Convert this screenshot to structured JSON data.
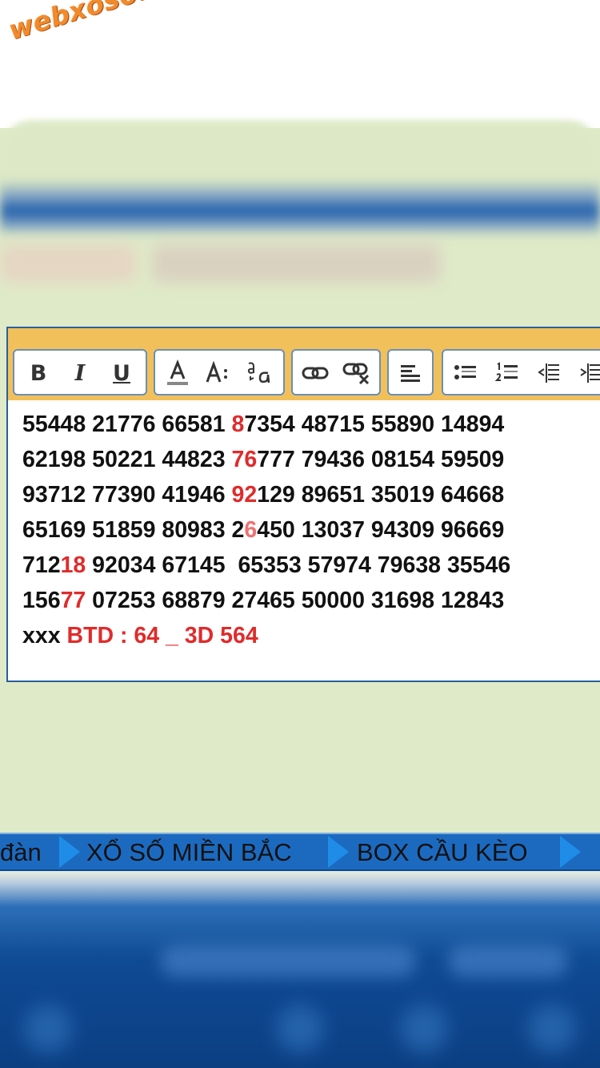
{
  "logo": {
    "text": "webxoso.net",
    "color": "#f28a2c"
  },
  "toolbar": {
    "bold_label": "B",
    "italic_label": "I",
    "underline_label": "U",
    "buttons": [
      "bold-icon",
      "italic-icon",
      "underline-icon",
      "font-color-icon",
      "font-size-icon",
      "font-face-icon",
      "link-icon",
      "unlink-icon",
      "align-left-icon",
      "bullet-list-icon",
      "numbered-list-icon",
      "outdent-icon",
      "indent-icon"
    ]
  },
  "post": {
    "lines": [
      [
        {
          "t": "55448 21776 66581 "
        },
        {
          "t": "8",
          "c": "red"
        },
        {
          "t": "7354 48715 55890 14894"
        }
      ],
      [
        {
          "t": "62198 50221 44823 "
        },
        {
          "t": "76",
          "c": "red"
        },
        {
          "t": "777 79436 08154 59509"
        }
      ],
      [
        {
          "t": "93712 77390 41946 "
        },
        {
          "t": "92",
          "c": "red"
        },
        {
          "t": "129 89651 35019 64668"
        }
      ],
      [
        {
          "t": "65169 51859 80983 2"
        },
        {
          "t": "6",
          "c": "pink"
        },
        {
          "t": "450 13037 94309 96669"
        }
      ],
      [
        {
          "t": "712"
        },
        {
          "t": "18",
          "c": "red"
        },
        {
          "t": " 92034 67145  65353 57974 79638 35546"
        }
      ],
      [
        {
          "t": "156"
        },
        {
          "t": "77",
          "c": "red"
        },
        {
          "t": " 07253 68879 27465 50000 31698 12843"
        }
      ],
      [
        {
          "t": "xxx "
        },
        {
          "t": "BTD : 64 _ 3D 564",
          "c": "red"
        }
      ]
    ]
  },
  "nav": {
    "items": [
      "đàn",
      "XỔ SỐ MIỀN BẮC",
      "BOX CẦU KÈO"
    ]
  },
  "colors": {
    "accent_red": "#e02b2b",
    "nav_blue": "#1c6ac0",
    "toolbar_gold": "#f2c05a",
    "page_green": "#dfeac8"
  }
}
